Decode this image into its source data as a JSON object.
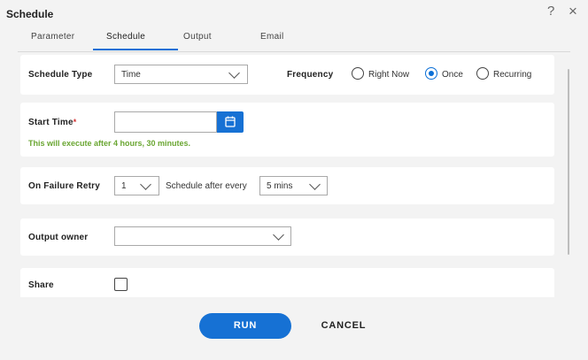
{
  "dialog": {
    "title": "Schedule",
    "help_icon": "question-mark-icon",
    "close_icon": "close-icon"
  },
  "tabs": [
    {
      "label": "Parameter",
      "active": false
    },
    {
      "label": "Schedule",
      "active": true
    },
    {
      "label": "Output",
      "active": false
    },
    {
      "label": "Email",
      "active": false
    }
  ],
  "schedule_type": {
    "label": "Schedule Type",
    "value": "Time"
  },
  "frequency": {
    "label": "Frequency",
    "options": [
      {
        "label": "Right Now",
        "selected": false
      },
      {
        "label": "Once",
        "selected": true
      },
      {
        "label": "Recurring",
        "selected": false
      }
    ]
  },
  "start_time": {
    "label": "Start Time",
    "required_mark": "*",
    "value": "",
    "hint": "This will execute after 4 hours, 30 minutes."
  },
  "failure_retry": {
    "label": "On Failure Retry",
    "value": "1",
    "after_label": "Schedule after every",
    "after_value": "5 mins"
  },
  "output_owner": {
    "label": "Output owner",
    "value": ""
  },
  "share": {
    "label": "Share",
    "checked": false
  },
  "buttons": {
    "run": "RUN",
    "cancel": "CANCEL"
  },
  "colors": {
    "accent": "#1671d4",
    "hint": "#6aa632",
    "required": "#d32f2f"
  }
}
